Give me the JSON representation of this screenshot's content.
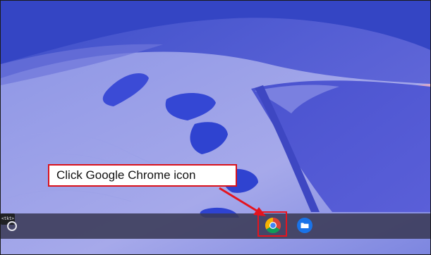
{
  "shelf": {
    "launcher": {
      "icon": "launcher-circle-icon"
    },
    "apps": [
      {
        "icon": "chrome-icon",
        "color": "#db4437"
      },
      {
        "icon": "files-icon",
        "color": "#1a73e8"
      },
      {
        "icon": "terminal-icon",
        "glyph": "<tkt>"
      }
    ]
  },
  "annotation": {
    "callout_text": "Click Google Chrome icon",
    "accent_color": "#e5141e"
  }
}
